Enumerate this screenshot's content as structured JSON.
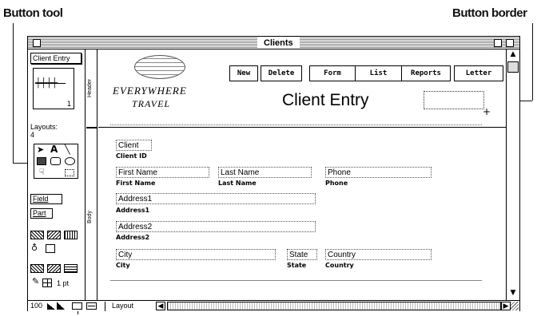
{
  "callouts": {
    "button_tool": "Button tool",
    "button_border": "Button border"
  },
  "window": {
    "title": "Clients"
  },
  "tools": {
    "layout_name": "Client Entry",
    "layout_page": "1",
    "layouts_label": "Layouts:",
    "layouts_count": "4",
    "field_label": "Field",
    "part_label": "Part",
    "line_width": "1 pt",
    "text_tool": "A",
    "button_tool_glyph": "☟"
  },
  "parts": {
    "header": "Header",
    "body": "Body"
  },
  "header": {
    "logo_line1": "EVERYWHERE",
    "logo_line2": "TRAVEL",
    "title": "Client Entry",
    "buttons": [
      {
        "label": "New"
      },
      {
        "label": "Delete"
      },
      {
        "label": "Form"
      },
      {
        "label": "List"
      },
      {
        "label": "Reports"
      },
      {
        "label": "Letter"
      }
    ]
  },
  "body_fields": {
    "client": {
      "field": "Client",
      "label": "Client ID"
    },
    "first_name": {
      "field": "First Name",
      "label": "First Name"
    },
    "last_name": {
      "field": "Last Name",
      "label": "Last Name"
    },
    "phone": {
      "field": "Phone",
      "label": "Phone"
    },
    "address1": {
      "field": "Address1",
      "label": "Address1"
    },
    "address2": {
      "field": "Address2",
      "label": "Address2"
    },
    "city": {
      "field": "City",
      "label": "City"
    },
    "state": {
      "field": "State",
      "label": "State"
    },
    "country": {
      "field": "Country",
      "label": "Country"
    }
  },
  "statusbar": {
    "zoom": "100",
    "mode": "Layout"
  }
}
